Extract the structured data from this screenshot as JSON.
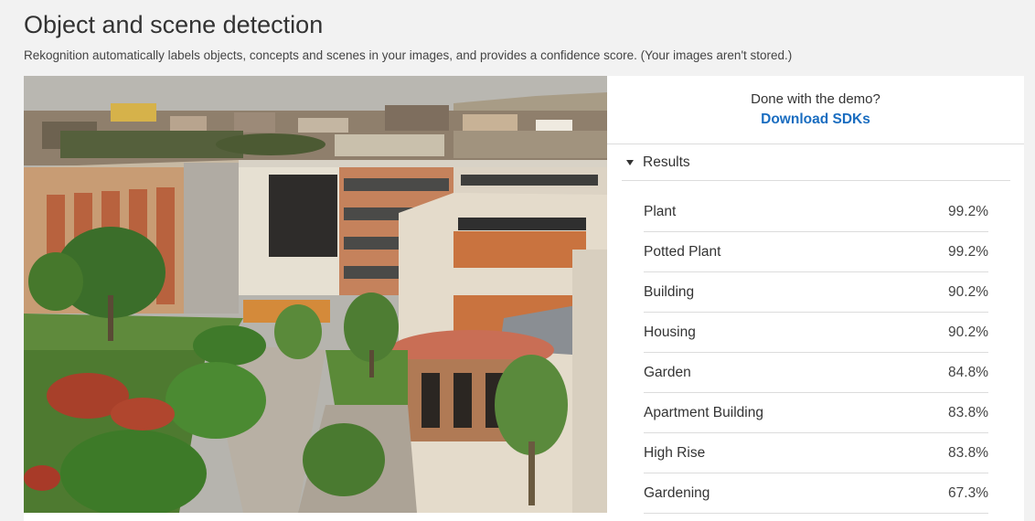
{
  "page": {
    "title": "Object and scene detection",
    "subtitle": "Rekognition automatically labels objects, concepts and scenes in your images, and provides a confidence score. (Your images aren't stored.)"
  },
  "demo": {
    "prompt": "Done with the demo?",
    "link_label": "Download SDKs"
  },
  "results": {
    "header": "Results",
    "items": [
      {
        "label": "Plant",
        "confidence": "99.2%"
      },
      {
        "label": "Potted Plant",
        "confidence": "99.2%"
      },
      {
        "label": "Building",
        "confidence": "90.2%"
      },
      {
        "label": "Housing",
        "confidence": "90.2%"
      },
      {
        "label": "Garden",
        "confidence": "84.8%"
      },
      {
        "label": "Apartment Building",
        "confidence": "83.8%"
      },
      {
        "label": "High Rise",
        "confidence": "83.8%"
      },
      {
        "label": "Gardening",
        "confidence": "67.3%"
      }
    ]
  },
  "colors": {
    "accent_link": "#1a6dc0",
    "background": "#f2f2f2"
  }
}
